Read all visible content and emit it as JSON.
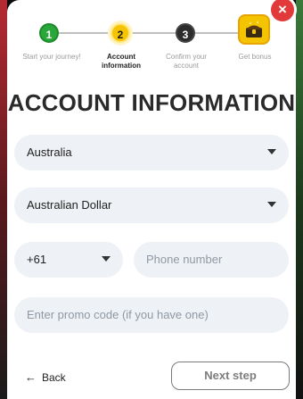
{
  "stepper": {
    "steps": [
      {
        "number": "1",
        "label": "Start your journey!"
      },
      {
        "number": "2",
        "label": "Account\ninformation"
      },
      {
        "number": "3",
        "label": "Confirm your\naccount"
      },
      {
        "number": "",
        "label": "Get bonus"
      }
    ]
  },
  "page": {
    "title": "ACCOUNT INFORMATION"
  },
  "form": {
    "country": {
      "value": "Australia"
    },
    "currency": {
      "value": "Australian Dollar"
    },
    "phone_code": {
      "value": "+61"
    },
    "phone": {
      "placeholder": "Phone number"
    },
    "promo": {
      "placeholder": "Enter promo code (if you have one)"
    }
  },
  "actions": {
    "back_label": "Back",
    "back_icon": "←",
    "next_label": "Next step"
  },
  "icons": {
    "close": "×",
    "bonus": "treasure-chest"
  },
  "colors": {
    "step_1": "#2aa63a",
    "step_2": "#f5c400",
    "step_3": "#2c2c2c",
    "close": "#e23a3a",
    "field_bg": "#eef1f5"
  }
}
